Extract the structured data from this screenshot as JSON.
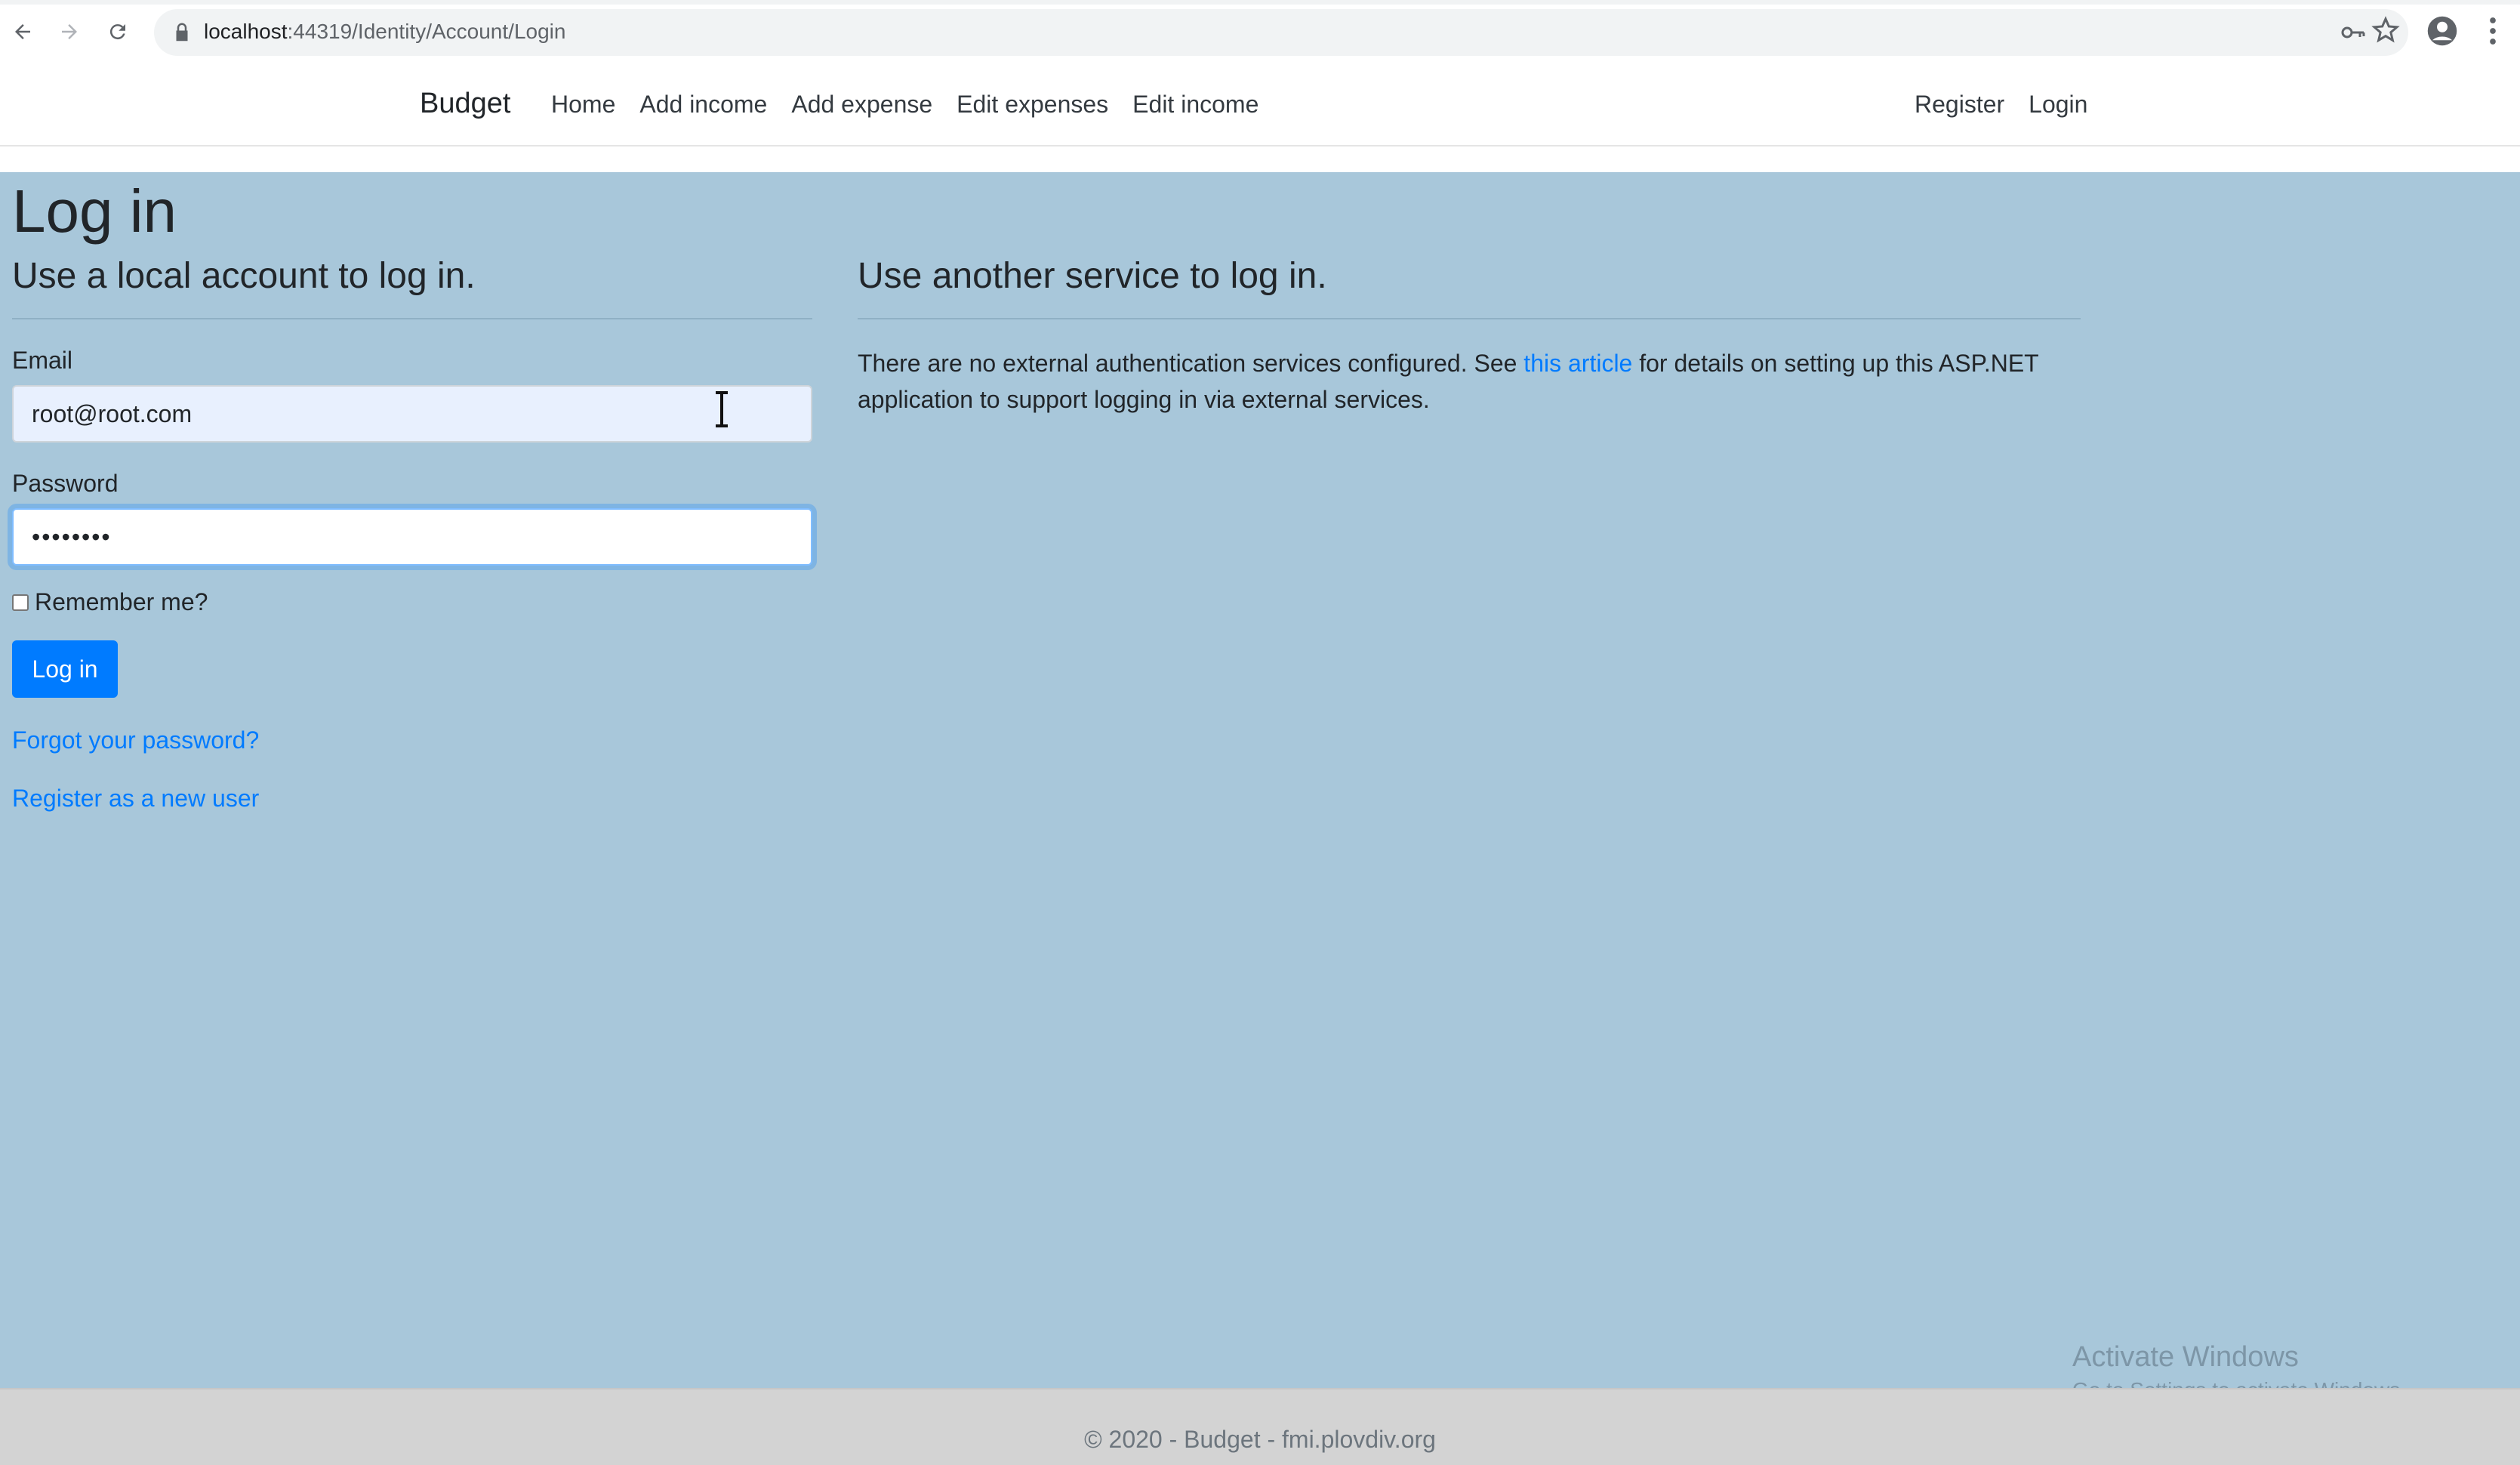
{
  "browser": {
    "url_host": "localhost",
    "url_path": ":44319/Identity/Account/Login",
    "back_icon": "arrow-left-icon",
    "forward_icon": "arrow-right-icon",
    "reload_icon": "reload-icon"
  },
  "navbar": {
    "brand": "Budget",
    "links": [
      "Home",
      "Add income",
      "Add expense",
      "Edit expenses",
      "Edit income"
    ],
    "right_links": [
      "Register",
      "Login"
    ]
  },
  "page": {
    "title": "Log in",
    "local": {
      "heading": "Use a local account to log in.",
      "email_label": "Email",
      "email_value": "root@root.com",
      "password_label": "Password",
      "password_value": "••••••••",
      "remember_label": "Remember me?",
      "remember_checked": false,
      "login_button": "Log in",
      "forgot_link": "Forgot your password?",
      "register_link": "Register as a new user"
    },
    "external": {
      "heading": "Use another service to log in.",
      "text_before": "There are no external authentication services configured. See ",
      "link_text": "this article",
      "text_after": " for details on setting up this ASP.NET application to support logging in via external services."
    }
  },
  "watermark": {
    "title": "Activate Windows",
    "subtitle": "Go to Settings to activate Windows."
  },
  "footer": {
    "text": "© 2020 - Budget - fmi.plovdiv.org"
  },
  "colors": {
    "page_background": "#a8c7da",
    "primary": "#007bff",
    "footer_background": "#d3d3d3"
  }
}
